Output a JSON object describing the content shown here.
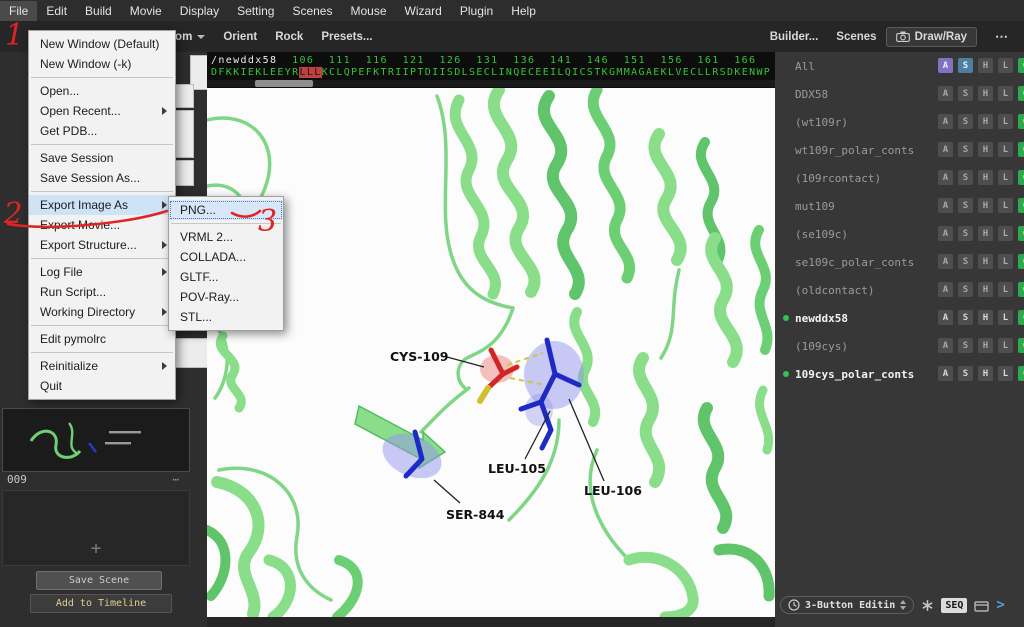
{
  "menubar": {
    "items": [
      "File",
      "Edit",
      "Build",
      "Movie",
      "Display",
      "Setting",
      "Scenes",
      "Mouse",
      "Wizard",
      "Plugin",
      "Help"
    ]
  },
  "toolbar": {
    "zoom": "Zoom",
    "orient": "Orient",
    "rock": "Rock",
    "presets": "Presets...",
    "builder": "Builder...",
    "scenes": "Scenes",
    "draw_ray": "Draw/Ray",
    "more": "⋯"
  },
  "file_menu": {
    "items": [
      "New Window (Default)",
      "New Window (-k)",
      "Open...",
      "Open Recent...",
      "Get PDB...",
      "Save Session",
      "Save Session As...",
      "Export Image As",
      "Export Movie...",
      "Export Structure...",
      "Log File",
      "Run Script...",
      "Working Directory",
      "Edit pymolrc",
      "Reinitialize",
      "Quit"
    ]
  },
  "export_submenu": {
    "items": [
      "PNG...",
      "VRML 2...",
      "COLLADA...",
      "GLTF...",
      "POV-Ray...",
      "STL..."
    ]
  },
  "sequence": {
    "object": "/newddx58",
    "numbers": "  106  111  116  121  126  131  136  141  146  151  156  161  166",
    "pre": "DFKKIEKLEEYR",
    "selected": "LLL",
    "post": "KCLQPEFKTRIIPTDIISDLSECLINQECEEILQICSTKGMMAGAEKLVECLLRSDKENWP"
  },
  "viewport_labels": {
    "cys109": "CYS-109",
    "leu105": "LEU-105",
    "leu106": "LEU-106",
    "ser844": "SER-844"
  },
  "object_panel": {
    "button_letters": [
      "A",
      "S",
      "H",
      "L",
      "C"
    ],
    "rows": [
      {
        "name": "All"
      },
      {
        "name": "DDX58"
      },
      {
        "name": "(wt109r)"
      },
      {
        "name": "wt109r_polar_conts"
      },
      {
        "name": "(109rcontact)"
      },
      {
        "name": "mut109"
      },
      {
        "name": "(se109c)"
      },
      {
        "name": "se109c_polar_conts"
      },
      {
        "name": "(oldcontact)"
      },
      {
        "name": "newddx58"
      },
      {
        "name": "(109cys)"
      },
      {
        "name": "109cys_polar_conts"
      }
    ]
  },
  "left_panel": {
    "scene_id": "009",
    "menu_dots": "⋯",
    "plus": "+",
    "save_scene": "Save Scene",
    "add_to_timeline": "Add to Timeline"
  },
  "statusbar": {
    "mouse_mode": "3-Button Editin",
    "seq": "SEQ",
    "chevron": ">"
  },
  "annotations": {
    "step1": "1",
    "step2": "2",
    "step3": "3"
  },
  "colors": {
    "annotation_red": "#e02424",
    "protein_green": "#8ade8a",
    "stick_blue": "#1d2bc4",
    "stick_red": "#d02626",
    "contact_yellow": "#c9c93a",
    "object_green_dot": "#35c24f",
    "selection_red_bg": "#c04040",
    "sequence_green": "#35c435",
    "menu_highlight": "#cfe3f7"
  }
}
